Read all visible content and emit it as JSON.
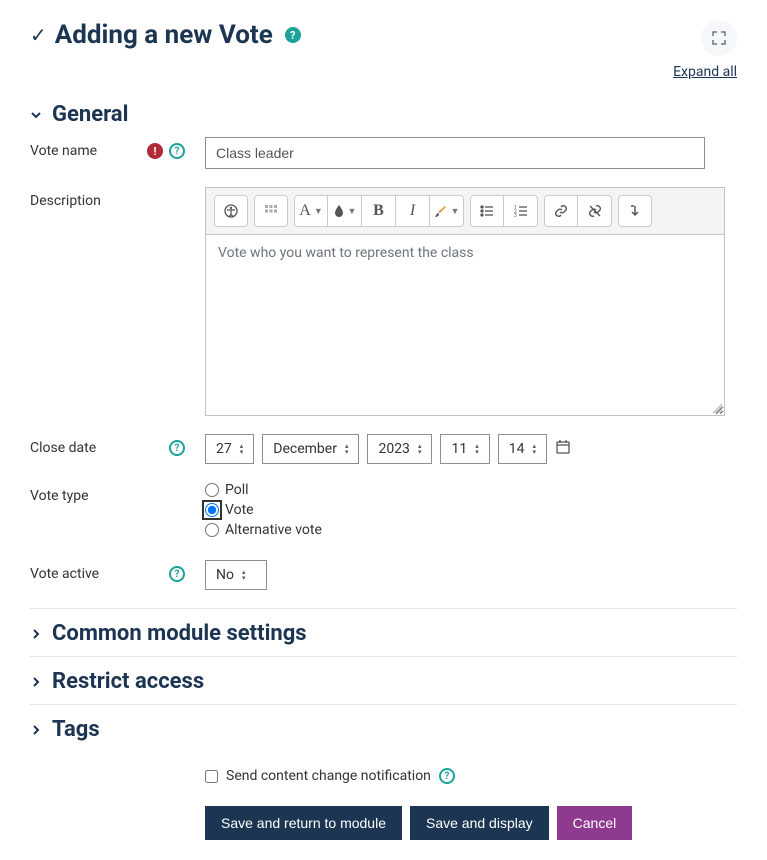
{
  "header": {
    "title": "Adding a new Vote",
    "expand_all": "Expand all"
  },
  "sections": {
    "general": "General",
    "common": "Common module settings",
    "restrict": "Restrict access",
    "tags": "Tags"
  },
  "labels": {
    "vote_name": "Vote name",
    "description": "Description",
    "close_date": "Close date",
    "vote_type": "Vote type",
    "vote_active": "Vote active",
    "notify": "Send content change notification"
  },
  "values": {
    "vote_name": "Class leader",
    "description": "Vote who you want to represent the class",
    "close_date": {
      "day": "27",
      "month": "December",
      "year": "2023",
      "hour": "11",
      "minute": "14"
    },
    "vote_type_options": {
      "poll": "Poll",
      "vote": "Vote",
      "alt": "Alternative vote"
    },
    "vote_type_selected": "vote",
    "vote_active": "No"
  },
  "buttons": {
    "save_return": "Save and return to module",
    "save_display": "Save and display",
    "cancel": "Cancel"
  },
  "toolbar": {
    "font_letter": "A",
    "bold": "B",
    "italic": "I"
  }
}
